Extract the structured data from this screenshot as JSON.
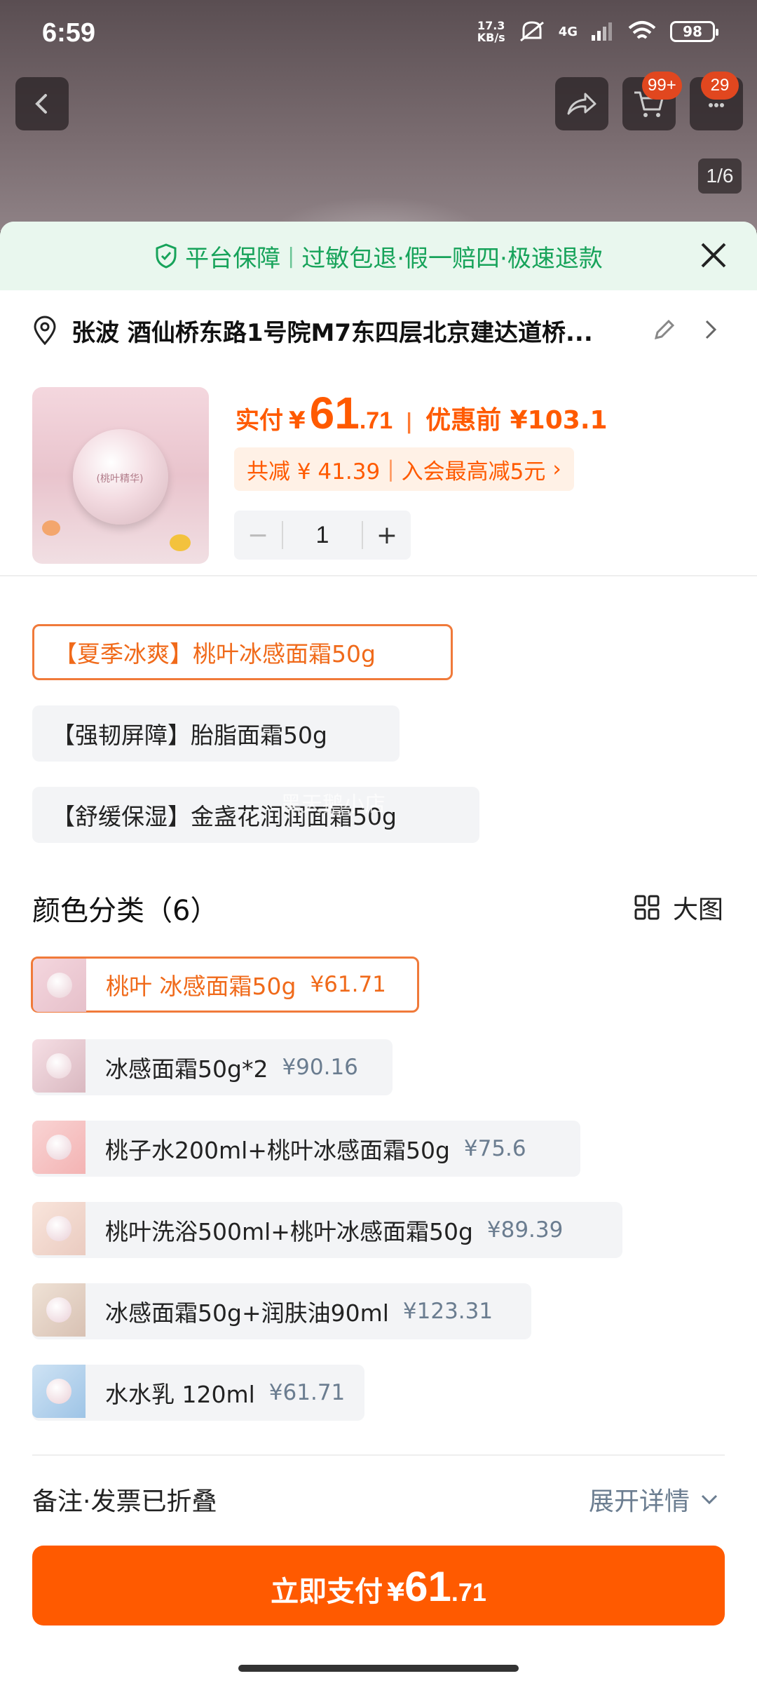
{
  "status": {
    "time": "6:59",
    "speed_top": "17.3",
    "speed_bottom": "KB/s",
    "network": "4G",
    "battery": "98"
  },
  "nav": {
    "cart_badge": "99+",
    "msg_badge": "29",
    "pager": "1/6"
  },
  "guarantee": {
    "title": "平台保障",
    "items": "过敏包退·假一赔四·极速退款"
  },
  "address": {
    "text": "张波 酒仙桥东路1号院M7东四层北京建达道桥..."
  },
  "product": {
    "jar_label": "(桃叶精华)"
  },
  "price": {
    "pay_label": "实付",
    "currency": "¥",
    "integer": "61",
    "decimal": ".71",
    "separator": "|",
    "original": "优惠前 ¥103.1"
  },
  "discount": {
    "total": "共减 ¥ 41.39",
    "member": "入会最高减5元",
    "separator": "|",
    "arrow": "›"
  },
  "quantity": {
    "value": "1",
    "minus": "−",
    "plus": "+"
  },
  "versions": {
    "items": [
      {
        "label": "【夏季冰爽】桃叶冰感面霜50g",
        "selected": true
      },
      {
        "label": "【强韧屏障】胎脂面霜50g",
        "selected": false
      },
      {
        "label": "【舒缓保湿】金盏花润润面霜50g",
        "selected": false
      }
    ]
  },
  "colors": {
    "title": "颜色分类（6）",
    "big_view": "大图",
    "items": [
      {
        "label": "桃叶 冰感面霜50g",
        "price": "¥61.71",
        "selected": true
      },
      {
        "label": "冰感面霜50g*2",
        "price": "¥90.16",
        "selected": false
      },
      {
        "label": "桃子水200ml+桃叶冰感面霜50g",
        "price": "¥75.6",
        "selected": false
      },
      {
        "label": "桃叶洗浴500ml+桃叶冰感面霜50g",
        "price": "¥89.39",
        "selected": false
      },
      {
        "label": "冰感面霜50g+润肤油90ml",
        "price": "¥123.31",
        "selected": false
      },
      {
        "label": "水水乳 120ml",
        "price": "¥61.71",
        "selected": false
      }
    ]
  },
  "footer": {
    "remark": "备注·发票已折叠",
    "expand": "展开详情"
  },
  "pay_button": {
    "label": "立即支付",
    "currency": "¥",
    "integer": "61",
    "decimal": ".71"
  },
  "watermark": "黑天鹅小店",
  "colors_theme": {
    "accent": "#ff5a00",
    "green": "#17a35a",
    "gray_price": "#6b7d90"
  }
}
